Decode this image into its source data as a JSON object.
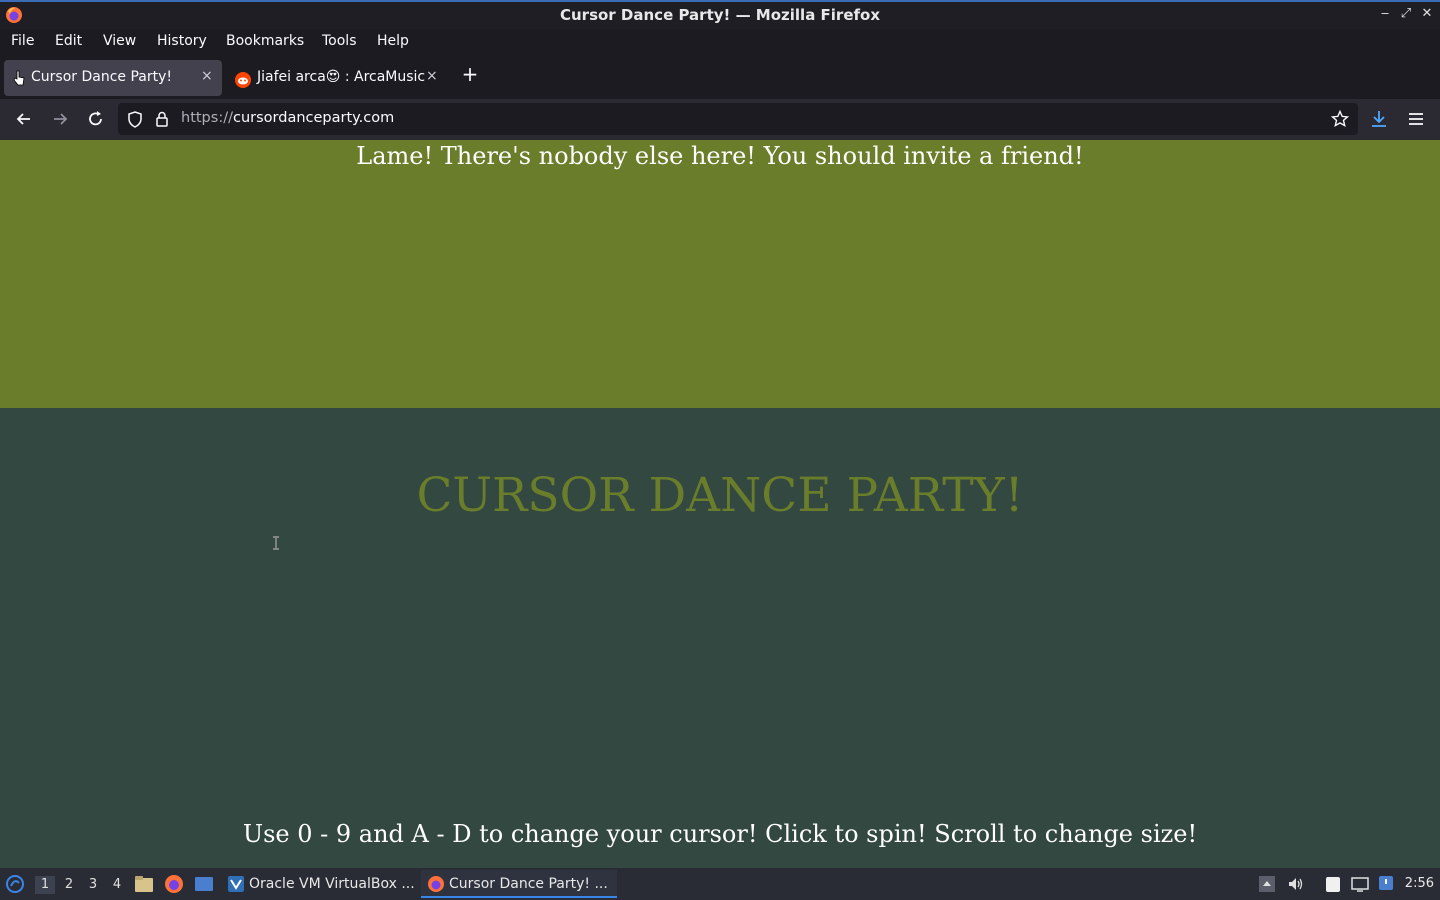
{
  "window": {
    "title": "Cursor Dance Party! — Mozilla Firefox"
  },
  "menubar": {
    "items": [
      "File",
      "Edit",
      "View",
      "History",
      "Bookmarks",
      "Tools",
      "Help"
    ]
  },
  "tabs": [
    {
      "label": "Cursor Dance Party!",
      "active": true,
      "close": "×"
    },
    {
      "label": "Jiafei arca😍 : ArcaMusic",
      "active": false,
      "close": "×"
    }
  ],
  "newtab_label": "+",
  "navbar": {
    "url_protocol": "https://",
    "url_host": "cursordanceparty.com"
  },
  "page": {
    "top_message": "Lame! There's nobody else here! You should invite a friend!",
    "title": "CURSOR DANCE PARTY!",
    "help_text": "Use 0 - 9 and A - D to change your cursor! Click to spin! Scroll to change size!",
    "colors": {
      "top_panel": "#6a7d2a",
      "background": "#324840",
      "title": "#6a7d2a"
    }
  },
  "taskbar": {
    "workspaces": [
      "1",
      "2",
      "3",
      "4"
    ],
    "tasks": [
      {
        "label": "Oracle VM VirtualBox ...",
        "active": false
      },
      {
        "label": "Cursor Dance Party! ...",
        "active": true
      }
    ],
    "clock": "2:56"
  }
}
